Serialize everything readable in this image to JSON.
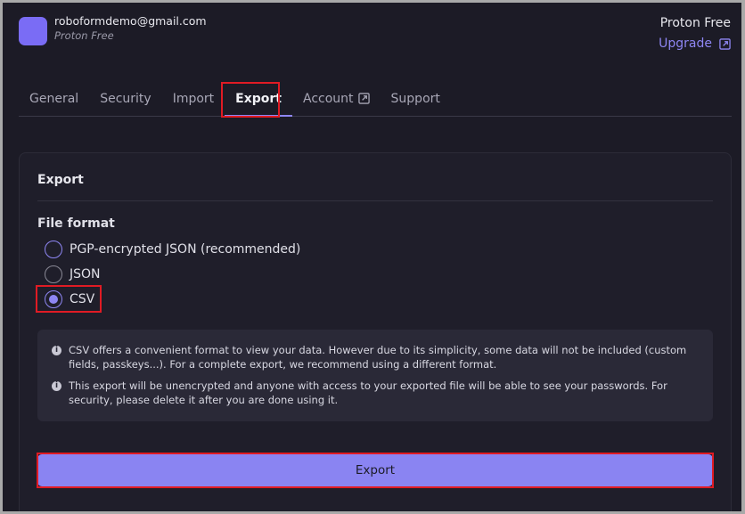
{
  "account": {
    "email": "roboformdemo@gmail.com",
    "plan_sub": "Proton Free",
    "plan_name": "Proton Free",
    "upgrade_label": "Upgrade"
  },
  "tabs": [
    {
      "label": "General"
    },
    {
      "label": "Security"
    },
    {
      "label": "Import"
    },
    {
      "label": "Export",
      "active": true
    },
    {
      "label": "Account",
      "external": true
    },
    {
      "label": "Support"
    }
  ],
  "panel": {
    "title": "Export",
    "file_format_label": "File format",
    "options": [
      {
        "label": "PGP-encrypted JSON (recommended)",
        "checked": false
      },
      {
        "label": "JSON",
        "checked": false
      },
      {
        "label": "CSV",
        "checked": true
      }
    ],
    "info": [
      "CSV offers a convenient format to view your data. However due to its simplicity, some data will not be included (custom fields, passkeys...). For a complete export, we recommend using a different format.",
      "This export will be unencrypted and anyone with access to your exported file will be able to see your passwords. For security, please delete it after you are done using it."
    ],
    "export_button": "Export"
  },
  "icons": {
    "info": "info-icon",
    "external": "external-link-icon"
  },
  "colors": {
    "accent": "#8e86f3",
    "background": "#1c1b26",
    "highlight": "#e01b24"
  }
}
